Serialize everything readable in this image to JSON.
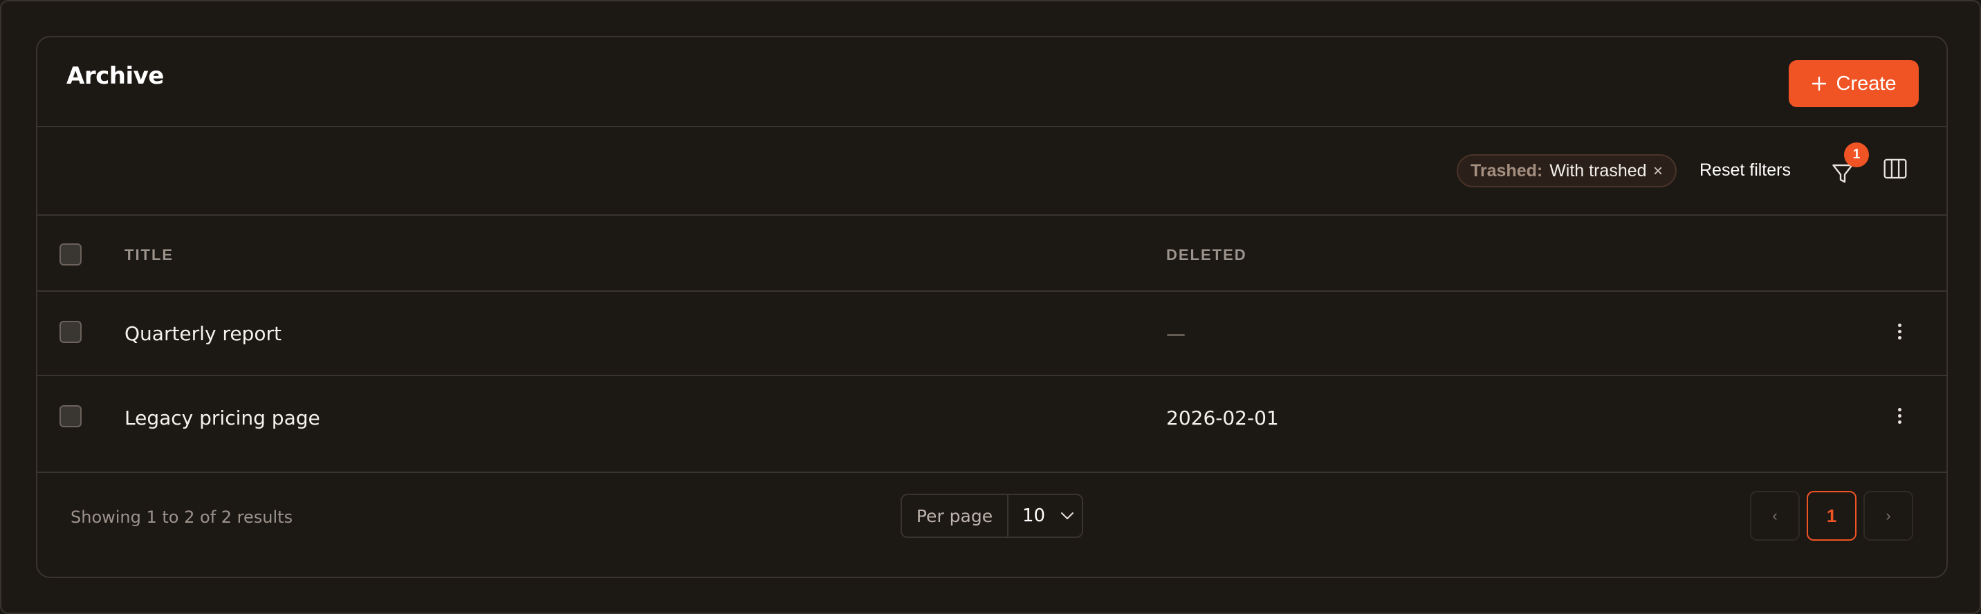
{
  "header": {
    "title": "Archive",
    "create_label": "Create"
  },
  "toolbar": {
    "filter_chip": {
      "label": "Trashed:",
      "value": "With trashed",
      "remove": "×"
    },
    "reset_label": "Reset filters",
    "filter_count": "1"
  },
  "table": {
    "columns": {
      "title": "TITLE",
      "deleted": "DELETED"
    },
    "rows": [
      {
        "title": "Quarterly report",
        "deleted": "—"
      },
      {
        "title": "Legacy pricing page",
        "deleted": "2026-02-01"
      }
    ]
  },
  "footer": {
    "results_text": "Showing 1 to 2 of 2 results",
    "per_page_label": "Per page",
    "per_page_value": "10",
    "prev": "‹",
    "current_page": "1",
    "next": "›"
  },
  "colors": {
    "accent": "#f05424",
    "background": "#1c1814",
    "border": "#3a342e"
  },
  "icons": [
    "plus-icon",
    "close-icon",
    "filter-icon",
    "columns-icon",
    "more-vertical-icon",
    "chevron-down-icon"
  ]
}
